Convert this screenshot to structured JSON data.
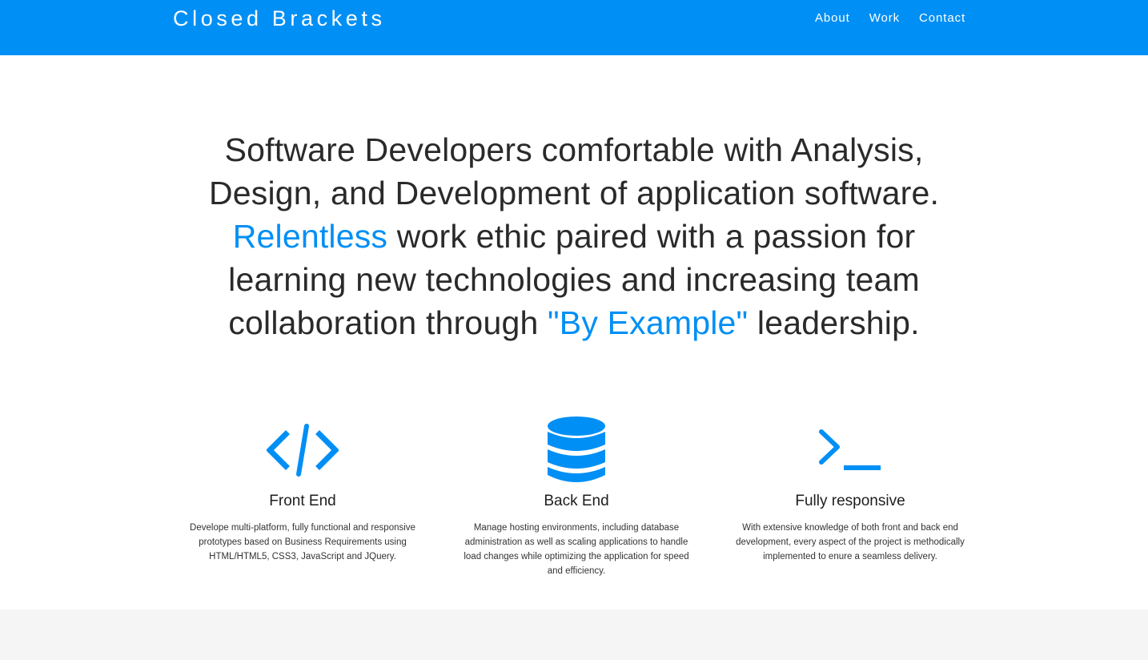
{
  "header": {
    "brand": "Closed Brackets",
    "nav": [
      {
        "label": "About"
      },
      {
        "label": "Work"
      },
      {
        "label": "Contact"
      }
    ]
  },
  "hero": {
    "line1": "Software Developers comfortable with Analysis, Design, and Development of application software.",
    "accent1": "Relentless",
    "line2": " work ethic paired with a passion for learning new technologies and increasing team collaboration through ",
    "accent2": "\"By Example\"",
    "line3": " leadership."
  },
  "features": [
    {
      "icon": "code-brackets-icon",
      "title": "Front End",
      "text": "Develope multi-platform, fully functional and responsive prototypes based on Business Requirements using HTML/HTML5, CSS3, JavaScript and JQuery."
    },
    {
      "icon": "database-icon",
      "title": "Back End",
      "text": "Manage hosting environments, including database administration as well as scaling applications to handle load changes while optimizing the application for speed and efficiency."
    },
    {
      "icon": "terminal-prompt-icon",
      "title": "Fully responsive",
      "text": "With extensive knowledge of both front and back end development, every aspect of the project is methodically implemented to enure a seamless delivery."
    }
  ],
  "colors": {
    "accent": "#008ff5",
    "text": "#2a2a2a",
    "footer_band": "#f5f5f5"
  }
}
